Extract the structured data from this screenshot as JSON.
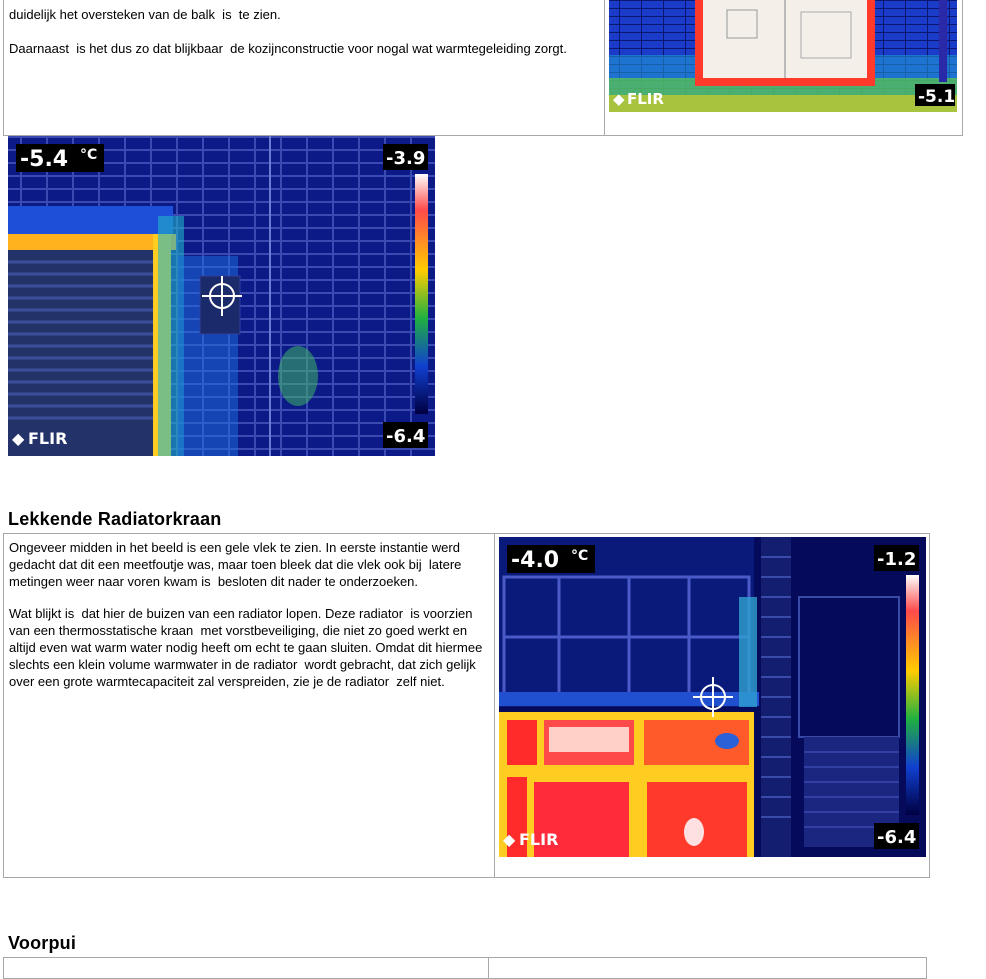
{
  "section_top": {
    "paragraph1": "duidelijk het oversteken van de balk  is  te zien.",
    "paragraph2": "Daarnaast  is het dus zo dat blijkbaar  de kozijnconstructie voor nogal wat warmtegeleiding zorgt.",
    "image": {
      "min": "-5.1",
      "brand": "FLIR"
    }
  },
  "standalone_image": {
    "spot": "-5.4",
    "unit": "°C",
    "max": "-3.9",
    "min": "-6.4",
    "brand": "FLIR"
  },
  "section_radiator": {
    "heading": "Lekkende  Radiatorkraan",
    "paragraph1": "Ongeveer midden in het beeld is een gele vlek te zien. In eerste instantie werd gedacht dat dit een meetfoutje was, maar toen bleek dat die vlek ook bij  latere metingen weer naar voren kwam is  besloten dit nader te onderzoeken.",
    "paragraph2": "Wat blijkt is  dat hier de buizen van een radiator lopen. Deze radiator  is voorzien van een thermosstatische kraan  met vorstbeveiliging, die niet zo goed werkt en altijd even wat warm water nodig heeft om echt te gaan sluiten. Omdat dit hiermee slechts een klein volume warmwater in de radiator  wordt gebracht, dat zich gelijk over een grote warmtecapaciteit zal verspreiden, zie je de radiator  zelf niet.",
    "image": {
      "spot": "-4.0",
      "unit": "°C",
      "max": "-1.2",
      "min": "-6.4",
      "brand": "FLIR"
    }
  },
  "section_voorpui": {
    "heading": "Voorpui"
  },
  "colors": {
    "border": "#a8a8a8",
    "thermal_bg": "#0a1a8c",
    "hot": "#ff2a2a",
    "warm": "#ffd400"
  }
}
